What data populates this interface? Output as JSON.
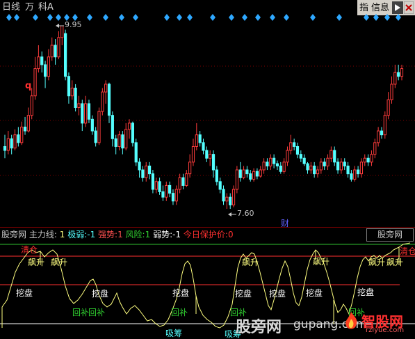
{
  "toolbar": {
    "period_label": "日线",
    "unit_label": "万",
    "stock_name": "科A",
    "index_btn": "指",
    "info_btn": "信息",
    "arrow_icon": "right-arrow-icon",
    "close_icon": "close-icon"
  },
  "kline": {
    "high_label": "9.95",
    "low_label": "7.60",
    "q_marker": "q",
    "cai_marker": "财",
    "up_color": "#ff3c3c",
    "down_color": "#54ffff",
    "candles": [
      [
        8.4,
        8.35,
        8.55,
        8.25
      ],
      [
        8.35,
        8.5,
        8.6,
        8.3
      ],
      [
        8.5,
        8.38,
        8.55,
        8.3
      ],
      [
        8.38,
        8.55,
        8.62,
        8.35
      ],
      [
        8.55,
        8.45,
        8.65,
        8.4
      ],
      [
        8.45,
        8.65,
        8.72,
        8.42
      ],
      [
        8.65,
        8.6,
        8.78,
        8.55
      ],
      [
        8.6,
        8.8,
        8.9,
        8.58
      ],
      [
        8.8,
        9.05,
        9.15,
        8.75
      ],
      [
        9.05,
        9.4,
        9.55,
        9.0
      ],
      [
        9.4,
        9.55,
        9.7,
        9.35
      ],
      [
        9.55,
        9.45,
        9.62,
        9.35
      ],
      [
        9.45,
        9.3,
        9.5,
        9.15
      ],
      [
        9.3,
        9.55,
        9.65,
        9.25
      ],
      [
        9.55,
        9.7,
        9.8,
        9.5
      ],
      [
        9.7,
        9.55,
        9.78,
        9.45
      ],
      [
        9.55,
        9.8,
        9.88,
        9.52
      ],
      [
        9.8,
        9.95,
        9.95,
        9.7
      ],
      [
        9.85,
        9.3,
        9.9,
        9.25
      ],
      [
        9.3,
        9.05,
        9.35,
        8.95
      ],
      [
        9.05,
        9.15,
        9.25,
        9.0
      ],
      [
        9.15,
        8.9,
        9.2,
        8.85
      ],
      [
        8.9,
        8.95,
        9.05,
        8.8
      ],
      [
        8.95,
        8.7,
        9.0,
        8.6
      ],
      [
        8.7,
        8.95,
        9.05,
        8.65
      ],
      [
        8.95,
        8.75,
        9.0,
        8.7
      ],
      [
        8.75,
        8.6,
        8.8,
        8.55
      ],
      [
        8.6,
        8.45,
        8.65,
        8.4
      ],
      [
        8.45,
        8.85,
        8.9,
        8.42
      ],
      [
        8.85,
        9.1,
        9.15,
        8.8
      ],
      [
        9.1,
        9.2,
        9.25,
        8.95
      ],
      [
        9.2,
        8.8,
        9.22,
        8.7
      ],
      [
        8.8,
        8.5,
        8.85,
        8.4
      ],
      [
        8.5,
        8.4,
        8.55,
        8.3
      ],
      [
        8.4,
        8.55,
        8.6,
        8.35
      ],
      [
        8.55,
        8.38,
        8.6,
        8.3
      ],
      [
        8.38,
        8.62,
        8.7,
        8.35
      ],
      [
        8.62,
        8.7,
        8.75,
        8.5
      ],
      [
        8.7,
        8.45,
        8.72,
        8.4
      ],
      [
        8.45,
        8.2,
        8.5,
        8.15
      ],
      [
        8.2,
        8.1,
        8.25,
        8.0
      ],
      [
        8.1,
        8.0,
        8.15,
        7.95
      ],
      [
        8.0,
        8.15,
        8.2,
        7.95
      ],
      [
        8.15,
        8.05,
        8.2,
        7.98
      ],
      [
        8.05,
        7.85,
        8.1,
        7.8
      ],
      [
        7.85,
        7.95,
        8.0,
        7.8
      ],
      [
        7.95,
        7.82,
        8.0,
        7.78
      ],
      [
        7.82,
        7.75,
        7.9,
        7.7
      ],
      [
        7.75,
        7.9,
        7.95,
        7.7
      ],
      [
        7.9,
        7.8,
        7.95,
        7.75
      ],
      [
        7.8,
        7.7,
        7.85,
        7.65
      ],
      [
        7.7,
        7.85,
        7.9,
        7.65
      ],
      [
        7.85,
        8.0,
        8.05,
        7.8
      ],
      [
        8.0,
        7.9,
        8.05,
        7.85
      ],
      [
        7.9,
        8.05,
        8.1,
        7.88
      ],
      [
        8.05,
        8.2,
        8.3,
        8.0
      ],
      [
        8.2,
        8.4,
        8.5,
        8.15
      ],
      [
        8.4,
        8.55,
        8.7,
        8.35
      ],
      [
        8.55,
        8.45,
        8.6,
        8.4
      ],
      [
        8.45,
        8.35,
        8.5,
        8.3
      ],
      [
        8.35,
        8.25,
        8.4,
        8.2
      ],
      [
        8.25,
        8.3,
        8.35,
        8.15
      ],
      [
        8.3,
        8.1,
        8.35,
        8.0
      ],
      [
        8.1,
        7.95,
        8.15,
        7.9
      ],
      [
        7.95,
        7.85,
        8.0,
        7.8
      ],
      [
        7.85,
        7.7,
        7.9,
        7.65
      ],
      [
        7.7,
        7.75,
        7.8,
        7.6
      ],
      [
        7.75,
        7.65,
        7.8,
        7.6
      ],
      [
        7.65,
        7.85,
        7.9,
        7.62
      ],
      [
        7.85,
        8.1,
        8.15,
        7.8
      ],
      [
        8.1,
        8.0,
        8.2,
        7.95
      ],
      [
        8.0,
        8.1,
        8.15,
        7.98
      ],
      [
        8.1,
        8.05,
        8.15,
        8.0
      ],
      [
        8.05,
        7.98,
        8.1,
        7.95
      ],
      [
        7.98,
        8.08,
        8.12,
        7.95
      ],
      [
        8.08,
        8.02,
        8.12,
        7.98
      ],
      [
        8.02,
        8.1,
        8.15,
        8.0
      ],
      [
        8.1,
        8.2,
        8.25,
        8.05
      ],
      [
        8.2,
        8.15,
        8.25,
        8.1
      ],
      [
        8.15,
        8.25,
        8.3,
        8.1
      ],
      [
        8.25,
        8.18,
        8.3,
        8.12
      ],
      [
        8.18,
        8.15,
        8.22,
        8.1
      ],
      [
        8.15,
        8.08,
        8.2,
        8.05
      ],
      [
        8.08,
        8.2,
        8.25,
        8.05
      ],
      [
        8.2,
        8.35,
        8.4,
        8.15
      ],
      [
        8.35,
        8.45,
        8.55,
        8.3
      ],
      [
        8.45,
        8.4,
        8.5,
        8.35
      ],
      [
        8.4,
        8.3,
        8.45,
        8.25
      ],
      [
        8.3,
        8.25,
        8.35,
        8.2
      ],
      [
        8.25,
        8.18,
        8.3,
        8.15
      ],
      [
        8.18,
        8.1,
        8.2,
        8.05
      ],
      [
        8.1,
        8.15,
        8.2,
        8.05
      ],
      [
        8.15,
        8.05,
        8.2,
        8.0
      ],
      [
        8.05,
        8.1,
        8.15,
        8.0
      ],
      [
        8.1,
        8.2,
        8.25,
        8.05
      ],
      [
        8.2,
        8.15,
        8.25,
        8.1
      ],
      [
        8.15,
        8.25,
        8.3,
        8.1
      ],
      [
        8.25,
        8.35,
        8.4,
        8.2
      ],
      [
        8.35,
        8.2,
        8.4,
        8.15
      ],
      [
        8.2,
        8.1,
        8.25,
        8.05
      ],
      [
        8.1,
        8.2,
        8.25,
        8.05
      ],
      [
        8.2,
        8.15,
        8.25,
        8.1
      ],
      [
        8.15,
        8.05,
        8.2,
        8.0
      ],
      [
        8.05,
        7.98,
        8.1,
        7.95
      ],
      [
        7.98,
        8.1,
        8.15,
        7.95
      ],
      [
        8.1,
        8.05,
        8.15,
        8.0
      ],
      [
        8.05,
        8.2,
        8.25,
        8.0
      ],
      [
        8.2,
        8.25,
        8.3,
        8.15
      ],
      [
        8.25,
        8.2,
        8.3,
        8.15
      ],
      [
        8.2,
        8.3,
        8.35,
        8.15
      ],
      [
        8.3,
        8.45,
        8.5,
        8.25
      ],
      [
        8.45,
        8.6,
        8.65,
        8.4
      ],
      [
        8.6,
        8.55,
        8.65,
        8.5
      ],
      [
        8.55,
        8.8,
        8.85,
        8.5
      ],
      [
        8.8,
        9.0,
        9.1,
        8.75
      ],
      [
        9.0,
        9.2,
        9.3,
        8.95
      ],
      [
        9.2,
        9.35,
        9.45,
        9.15
      ],
      [
        9.35,
        9.3,
        9.45,
        9.25
      ],
      [
        9.3,
        9.4,
        9.45,
        9.25
      ]
    ],
    "diamond_color": "#2ea8ff"
  },
  "indicator": {
    "title": "股旁网",
    "line_label": "主力线:",
    "line_value": "1",
    "jiruo_label": "极弱:",
    "jiruo_value": "-1",
    "qiangshi_label": "强势:",
    "qiangshi_value": "1",
    "fengxian_label": "风险:",
    "fengxian_value": "1",
    "ruoshi_label": "弱势:",
    "ruoshi_value": "-1",
    "baohu_label": "今日保护价:",
    "baohu_value": "0",
    "right_badge": "股旁网",
    "tags": {
      "qingcang": "清仓",
      "piaosheng": "飙升",
      "wapan": "挖盘",
      "huibu": "回补",
      "xichou": "吸筹"
    },
    "colors": {
      "main_line": "#ffff80",
      "white_line": "#ffffff",
      "red_line": "#ff3030",
      "green_line": "#20c020"
    }
  },
  "watermark": {
    "left_text": "股旁网",
    "url_text": "gupang.com",
    "logo_text": "智股网",
    "logo_url": "rzlyue.com"
  }
}
